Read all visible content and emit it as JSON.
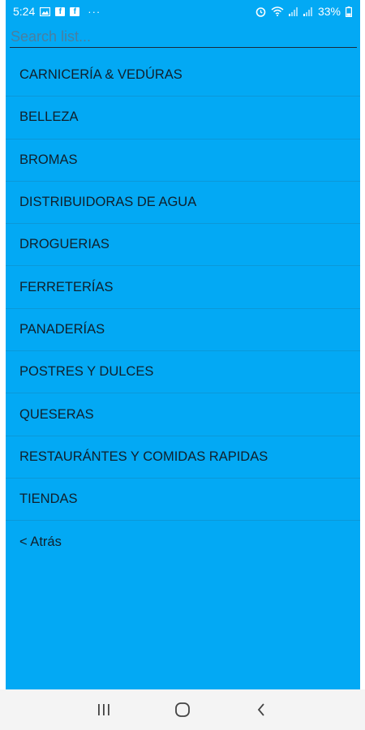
{
  "status_bar": {
    "time": "5:24",
    "dots": "···",
    "battery": "33%",
    "fb_glyph": "f"
  },
  "search": {
    "placeholder": "Search list..."
  },
  "list": {
    "items": [
      {
        "label": "CARNICERÍA & VEDÚRAS"
      },
      {
        "label": "BELLEZA"
      },
      {
        "label": "BROMAS"
      },
      {
        "label": "DISTRIBUIDORAS DE AGUA"
      },
      {
        "label": "DROGUERIAS"
      },
      {
        "label": "FERRETERÍAS"
      },
      {
        "label": "PANADERÍAS"
      },
      {
        "label": "POSTRES Y DULCES"
      },
      {
        "label": "QUESERAS"
      },
      {
        "label": "RESTAURÁNTES Y COMIDAS RAPIDAS"
      },
      {
        "label": "TIENDAS"
      }
    ],
    "back_label": "< Atrás"
  },
  "colors": {
    "app_background": "#03a9f4",
    "text": "#10202c",
    "nav_background": "#f4f4f4"
  },
  "icons": {
    "status_left": [
      "image-icon",
      "facebook-icon",
      "facebook-icon",
      "more-dots-icon"
    ],
    "status_right": [
      "alarm-icon",
      "wifi-icon",
      "signal-icon",
      "signal-icon",
      "battery-icon"
    ],
    "nav": [
      "recent-apps-icon",
      "home-icon",
      "back-icon"
    ]
  }
}
